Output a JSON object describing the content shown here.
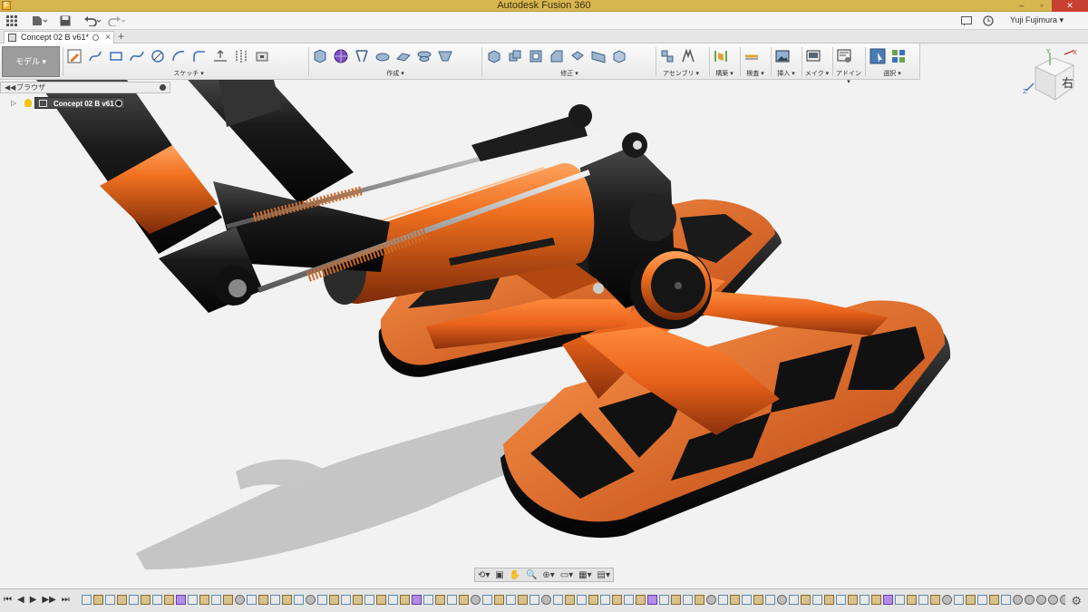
{
  "window": {
    "app_icon": "F",
    "title": "Autodesk Fusion 360",
    "controls": {
      "minimize": "–",
      "maximize": "▫",
      "close": "✕"
    }
  },
  "appbar": {
    "user_name": "Yuji Fujimura ▾",
    "icons": [
      "apps-grid-icon",
      "file-menu-icon",
      "save-icon",
      "undo-icon",
      "redo-icon",
      "job-status-icon",
      "help-clock-icon"
    ]
  },
  "tabs": [
    {
      "label": "Concept 02 B v61*",
      "active": true
    }
  ],
  "toolbar": {
    "workspace": "モデル ▾",
    "groups": [
      {
        "label": "スケッチ ▾",
        "icons": [
          "create-sketch-icon",
          "line-icon",
          "rectangle-icon",
          "spline-icon",
          "circle-icon",
          "arc-icon",
          "fillet-icon",
          "project-icon",
          "mirror-icon",
          "sketch-stop-icon"
        ]
      },
      {
        "label": "作成 ▾",
        "icons": [
          "box-icon",
          "sphere-icon",
          "pattern-icon",
          "extrude-icon",
          "sweep-icon",
          "loft-icon",
          "rib-icon"
        ]
      },
      {
        "label": "修正 ▾",
        "icons": [
          "press-pull-icon",
          "fillet-modify-icon",
          "shell-icon",
          "chamfer-icon",
          "split-icon",
          "scale-icon",
          "combine-icon"
        ]
      },
      {
        "label": "アセンブリ ▾",
        "icons": [
          "new-component-icon",
          "joint-icon"
        ]
      },
      {
        "label": "構築 ▾",
        "icons": [
          "plane-icon"
        ]
      },
      {
        "label": "検査 ▾",
        "icons": [
          "measure-icon"
        ]
      },
      {
        "label": "挿入 ▾",
        "icons": [
          "insert-image-icon"
        ]
      },
      {
        "label": "メイク ▾",
        "icons": [
          "3d-print-icon"
        ]
      },
      {
        "label": "アドイン ▾",
        "icons": [
          "scripts-icon"
        ]
      },
      {
        "label": "選択 ▾",
        "icons": [
          "select-icon",
          "window-select-icon"
        ]
      }
    ]
  },
  "browser": {
    "title": "ブラウザ",
    "root": "Concept 02 B v61"
  },
  "viewcube": {
    "face_label": "右",
    "axes": [
      "X",
      "Y",
      "Z"
    ]
  },
  "navbar": {
    "icons": [
      "orbit-icon",
      "look-at-icon",
      "pan-icon",
      "zoom-icon",
      "fit-icon",
      "display-settings-icon",
      "grid-icon",
      "viewports-icon"
    ],
    "glyphs": [
      "⟲▾",
      "▣",
      "✋",
      "🔍",
      "⊕▾",
      "▭▾",
      "▦▾",
      "▤▾"
    ]
  },
  "timeline": {
    "controls": [
      "⏮",
      "◀",
      "▶",
      "▶▶",
      "⏭"
    ],
    "settings_icon": "⚙",
    "item_count": 100
  },
  "colors": {
    "titlebar": "#d8b64f",
    "orange_body": "#e8621a",
    "black_body": "#111111",
    "background": "#f2f2f2"
  }
}
